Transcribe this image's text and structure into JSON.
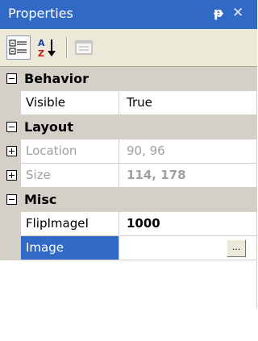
{
  "window": {
    "title": "Properties",
    "pin_glyph": "ᵽ",
    "close_glyph": "✕"
  },
  "toolbar": {
    "buttons": [
      {
        "name": "categorized-icon",
        "active": true
      },
      {
        "name": "alphabetical-icon",
        "active": false
      },
      {
        "name": "property-pages-icon",
        "active": false
      }
    ]
  },
  "categories": [
    {
      "label": "Behavior",
      "expanded": true,
      "properties": [
        {
          "name": "Visible",
          "value": "True",
          "readonly": false,
          "bold": false
        }
      ]
    },
    {
      "label": "Layout",
      "expanded": true,
      "properties": [
        {
          "name": "Location",
          "value": "90, 96",
          "readonly": true,
          "bold": false,
          "expandable": true
        },
        {
          "name": "Size",
          "value": "114, 178",
          "readonly": true,
          "bold": true,
          "expandable": true
        }
      ]
    },
    {
      "label": "Misc",
      "expanded": true,
      "properties": [
        {
          "name": "FlipImageI",
          "value": "1000",
          "readonly": false,
          "bold": true
        },
        {
          "name": "Image",
          "value": "",
          "selected": true,
          "button_label": "..."
        }
      ]
    }
  ],
  "colors": {
    "titlebar": "#316ac5",
    "selection": "#316ac5",
    "category_bg": "#d4d0c8",
    "readonly_text": "#a0a0a0"
  }
}
